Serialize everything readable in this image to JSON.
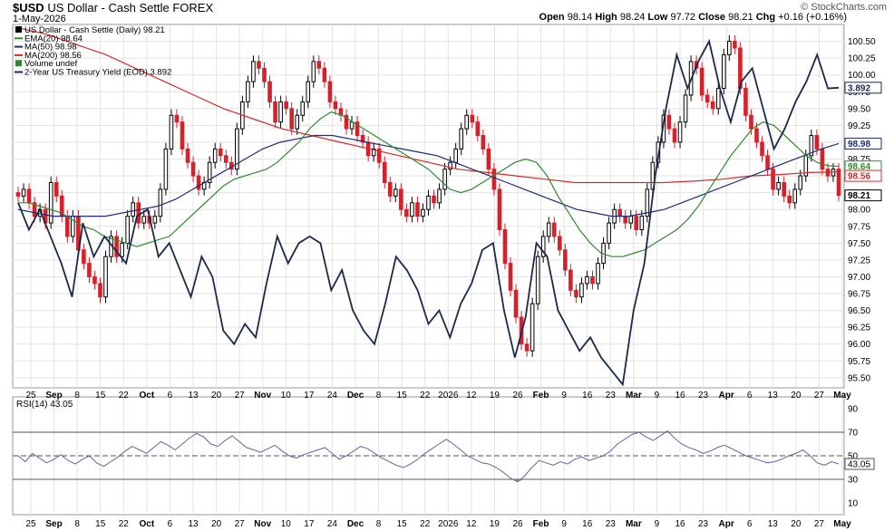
{
  "header": {
    "symbol": "$USD",
    "title": "US Dollar - Cash Settle",
    "exchange": "FOREX",
    "date": "1-May-2026",
    "brand": "© StockCharts.com",
    "ohlc": {
      "open_label": "Open",
      "open": "98.14",
      "high_label": "High",
      "high": "98.24",
      "low_label": "Low",
      "low": "97.72",
      "close_label": "Close",
      "close": "98.21",
      "chg_label": "Chg",
      "chg": "+0.16 (+0.16%)"
    }
  },
  "legend": [
    {
      "text": "US Dollar - Cash Settle (Daily) 98.21",
      "color": "#000000",
      "marker": "candle-icon"
    },
    {
      "text": "EMA(20) 98.64",
      "color": "#2e8b2e",
      "marker": "line"
    },
    {
      "text": "MA(50) 98.98",
      "color": "#1f2a7a",
      "marker": "line"
    },
    {
      "text": "MA(200) 98.56",
      "color": "#d42a2a",
      "marker": "line"
    },
    {
      "text": "Volume undef",
      "color": "#2e8b2e",
      "marker": "bars-icon"
    },
    {
      "text": "2-Year US Treasury Yield (EOD) 3.892",
      "color": "#1a2a4a",
      "marker": "line"
    }
  ],
  "rsi_label": "RSI(14) 43.05",
  "colors": {
    "up": "#000000",
    "down": "#d6202a",
    "ema20": "#2e8b2e",
    "ma50": "#1f2a7a",
    "ma200": "#d42a2a",
    "yield": "#1a2a4a",
    "rsi": "#5a6aa0",
    "grid": "#e3e3e3"
  },
  "chart_data": [
    {
      "type": "candlestick",
      "title": "US Dollar - Cash Settle (Daily)",
      "ylim": [
        95.35,
        100.75
      ],
      "y_ticks": [
        "100.50",
        "100.25",
        "100.00",
        "99.75",
        "99.50",
        "99.25",
        "99.00",
        "98.75",
        "98.50",
        "98.25",
        "98.00",
        "97.75",
        "97.50",
        "97.25",
        "97.00",
        "96.75",
        "96.50",
        "96.25",
        "96.00",
        "95.75",
        "95.50"
      ],
      "x_ticks": [
        "25",
        "Sep",
        "8",
        "15",
        "22",
        "Oct",
        "6",
        "13",
        "20",
        "27",
        "Nov",
        "10",
        "17",
        "24",
        "Dec",
        "8",
        "15",
        "22",
        "2026",
        "12",
        "19",
        "26",
        "Feb",
        "9",
        "16",
        "23",
        "Mar",
        "9",
        "16",
        "23",
        "Apr",
        "6",
        "13",
        "20",
        "27",
        "May"
      ],
      "value_tags": [
        {
          "label": "3.892",
          "value": 99.81,
          "style": "outline",
          "color": "#1a2a4a"
        },
        {
          "label": "98.98",
          "value": 98.98,
          "style": "outline",
          "color": "#1f2a7a"
        },
        {
          "label": "98.64",
          "value": 98.64,
          "style": "outline",
          "color": "#2e8b2e"
        },
        {
          "label": "98.56",
          "value": 98.5,
          "style": "outline",
          "color": "#d42a2a"
        },
        {
          "label": "98.21",
          "value": 98.21,
          "style": "outline",
          "color": "#000000"
        }
      ],
      "closes": [
        98.2,
        98.3,
        98.1,
        97.9,
        98.0,
        97.8,
        98.4,
        98.2,
        97.9,
        97.6,
        97.9,
        97.4,
        97.2,
        97.0,
        96.9,
        96.7,
        97.3,
        97.6,
        97.3,
        97.5,
        97.9,
        98.1,
        97.8,
        97.9,
        97.8,
        97.9,
        98.3,
        98.9,
        99.4,
        99.3,
        98.9,
        98.7,
        98.5,
        98.3,
        98.4,
        98.7,
        98.9,
        98.8,
        98.7,
        98.6,
        99.2,
        99.6,
        99.9,
        100.2,
        100.1,
        99.9,
        99.6,
        99.3,
        99.6,
        99.5,
        99.2,
        99.4,
        99.6,
        99.9,
        100.2,
        100.1,
        99.9,
        99.6,
        99.5,
        99.4,
        99.2,
        99.3,
        99.1,
        99.0,
        98.8,
        98.9,
        98.7,
        98.4,
        98.2,
        98.3,
        98.0,
        97.9,
        98.1,
        97.9,
        98.0,
        98.2,
        98.1,
        98.3,
        98.6,
        98.7,
        98.9,
        99.2,
        99.4,
        99.3,
        99.1,
        98.9,
        98.6,
        98.3,
        97.7,
        97.2,
        96.8,
        96.4,
        96.0,
        95.9,
        96.6,
        97.3,
        97.6,
        97.8,
        97.6,
        97.4,
        97.1,
        96.8,
        96.7,
        96.9,
        97.0,
        96.9,
        97.2,
        97.5,
        97.8,
        98.0,
        97.9,
        97.8,
        97.9,
        97.7,
        97.9,
        98.3,
        98.7,
        99.0,
        99.4,
        99.2,
        99.0,
        99.3,
        99.7,
        100.2,
        100.1,
        99.7,
        99.6,
        99.5,
        99.8,
        100.3,
        100.5,
        100.4,
        99.8,
        99.4,
        99.2,
        99.0,
        98.8,
        98.6,
        98.3,
        98.4,
        98.2,
        98.1,
        98.3,
        98.5,
        98.8,
        99.1,
        98.9,
        98.6,
        98.5,
        98.6,
        98.21
      ],
      "ema20": [
        98.1,
        98.1,
        98.05,
        98.0,
        97.95,
        97.85,
        97.75,
        97.7,
        97.6,
        97.55,
        97.5,
        97.45,
        97.5,
        97.55,
        97.6,
        97.75,
        97.9,
        98.05,
        98.2,
        98.35,
        98.45,
        98.5,
        98.55,
        98.6,
        98.7,
        98.85,
        99.0,
        99.2,
        99.35,
        99.45,
        99.4,
        99.3,
        99.2,
        99.1,
        99.0,
        98.9,
        98.8,
        98.7,
        98.6,
        98.45,
        98.3,
        98.25,
        98.3,
        98.4,
        98.5,
        98.6,
        98.7,
        98.75,
        98.7,
        98.5,
        98.2,
        97.95,
        97.7,
        97.5,
        97.35,
        97.3,
        97.3,
        97.35,
        97.4,
        97.5,
        97.6,
        97.7,
        97.85,
        98.05,
        98.3,
        98.55,
        98.8,
        99.0,
        99.2,
        99.3,
        99.25,
        99.1,
        98.95,
        98.8,
        98.7,
        98.65,
        98.64
      ],
      "ma50": [
        98.0,
        97.95,
        97.9,
        97.9,
        97.9,
        97.9,
        97.95,
        98.0,
        98.05,
        98.15,
        98.3,
        98.45,
        98.6,
        98.75,
        98.9,
        99.0,
        99.05,
        99.1,
        99.1,
        99.05,
        99.0,
        98.95,
        98.9,
        98.85,
        98.8,
        98.7,
        98.6,
        98.5,
        98.4,
        98.3,
        98.2,
        98.1,
        98.0,
        97.95,
        97.9,
        97.9,
        97.95,
        98.0,
        98.1,
        98.2,
        98.3,
        98.4,
        98.5,
        98.6,
        98.7,
        98.8,
        98.9,
        98.98
      ],
      "ma200": [
        100.7,
        100.6,
        100.45,
        100.3,
        100.1,
        99.9,
        99.7,
        99.5,
        99.35,
        99.2,
        99.1,
        99.0,
        98.9,
        98.8,
        98.7,
        98.6,
        98.55,
        98.5,
        98.45,
        98.4,
        98.4,
        98.4,
        98.4,
        98.42,
        98.45,
        98.5,
        98.52,
        98.55,
        98.56
      ],
      "yield_overlay": [
        98.1,
        97.7,
        98.0,
        97.6,
        97.2,
        96.7,
        97.8,
        97.3,
        97.6,
        97.4,
        97.2,
        97.9,
        98.0,
        97.3,
        97.5,
        97.1,
        96.7,
        97.3,
        97.0,
        96.2,
        96.0,
        96.3,
        96.1,
        96.9,
        97.6,
        97.2,
        97.5,
        97.6,
        97.5,
        96.8,
        97.1,
        96.5,
        96.2,
        96.0,
        96.6,
        97.3,
        97.1,
        96.8,
        96.3,
        96.5,
        96.1,
        96.6,
        96.9,
        97.4,
        97.5,
        96.5,
        95.8,
        96.4,
        97.5,
        97.3,
        96.5,
        96.2,
        95.9,
        96.1,
        95.8,
        95.6,
        95.4,
        96.5,
        97.2,
        98.5,
        99.5,
        100.3,
        99.8,
        100.2,
        100.5,
        99.8,
        99.3,
        99.9,
        100.1,
        99.5,
        98.9,
        99.2,
        99.6,
        99.9,
        100.3,
        99.8,
        99.81
      ]
    },
    {
      "type": "line",
      "title": "RSI(14)",
      "ylim": [
        0,
        100
      ],
      "y_ticks": [
        "90",
        "70",
        "50",
        "30",
        "10"
      ],
      "reference_lines": [
        70,
        50,
        30
      ],
      "value_tags": [
        {
          "label": "43.05",
          "value": 43.05
        }
      ],
      "x_ticks": [
        "25",
        "Sep",
        "8",
        "15",
        "22",
        "Oct",
        "6",
        "13",
        "20",
        "27",
        "Nov",
        "10",
        "17",
        "24",
        "Dec",
        "8",
        "15",
        "22",
        "2026",
        "12",
        "19",
        "26",
        "Feb",
        "9",
        "16",
        "23",
        "Mar",
        "9",
        "16",
        "23",
        "Apr",
        "6",
        "13",
        "20",
        "27",
        "May"
      ],
      "values": [
        50,
        45,
        52,
        48,
        44,
        47,
        51,
        46,
        43,
        47,
        50,
        44,
        41,
        45,
        49,
        54,
        58,
        55,
        52,
        57,
        62,
        59,
        55,
        60,
        65,
        69,
        66,
        60,
        58,
        63,
        67,
        62,
        57,
        55,
        53,
        56,
        59,
        54,
        50,
        48,
        51,
        53,
        55,
        57,
        52,
        47,
        50,
        54,
        58,
        56,
        52,
        48,
        45,
        42,
        40,
        43,
        47,
        52,
        56,
        60,
        64,
        60,
        55,
        50,
        47,
        44,
        43,
        40,
        36,
        31,
        28,
        33,
        40,
        46,
        44,
        42,
        45,
        43,
        47,
        49,
        46,
        48,
        50,
        54,
        60,
        64,
        68,
        70,
        66,
        63,
        67,
        71,
        65,
        60,
        57,
        55,
        52,
        54,
        57,
        59,
        56,
        53,
        50,
        48,
        46,
        44,
        45,
        47,
        50,
        52,
        55,
        50,
        44,
        42,
        45,
        43.05
      ]
    }
  ]
}
